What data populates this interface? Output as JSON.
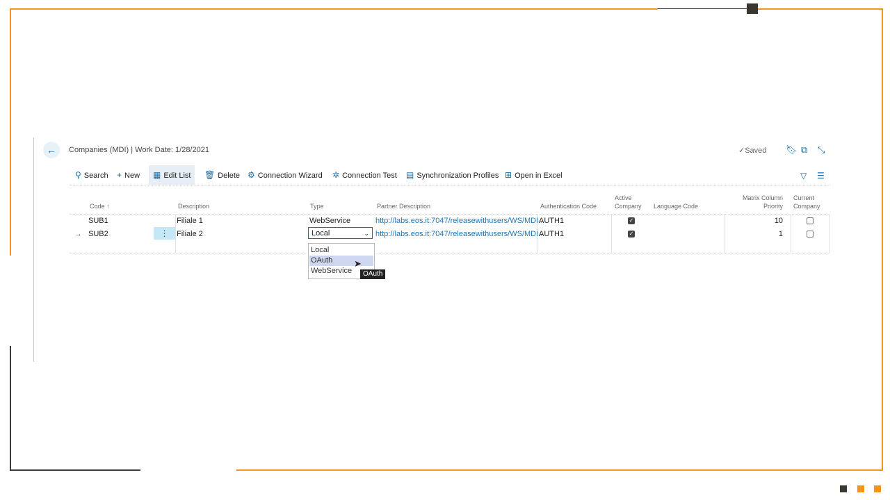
{
  "header": {
    "back_icon": "back-arrow-icon",
    "title": "Companies (MDI) | Work Date: 1/28/2021",
    "saved_label": "Saved"
  },
  "actions": [
    {
      "label": "Search",
      "icon": "search-icon"
    },
    {
      "label": "New",
      "icon": "plus-icon"
    },
    {
      "label": "Edit List",
      "icon": "edit-list-icon"
    },
    {
      "label": "Delete",
      "icon": "trash-icon"
    },
    {
      "label": "Connection Wizard",
      "icon": "wizard-icon"
    },
    {
      "label": "Connection Test",
      "icon": "connection-test-icon"
    },
    {
      "label": "Synchronization Profiles",
      "icon": "document-icon"
    },
    {
      "label": "Open in Excel",
      "icon": "excel-icon"
    }
  ],
  "columns": {
    "code": "Code ↑",
    "description": "Description",
    "type": "Type",
    "partner_description": "Partner Description",
    "authentication_code": "Authentication Code",
    "active_company_1": "Active",
    "active_company_2": "Company",
    "language_code": "Language Code",
    "matrix_1": "Matrix Column",
    "matrix_2": "Priority",
    "current_1": "Current",
    "current_2": "Company"
  },
  "rows": [
    {
      "code": "SUB1",
      "description": "Filiale 1",
      "type": "WebService",
      "partner_description": "http://labs.eos.it:7047/releasewithusers/WS/MDI...",
      "authentication_code": "AUTH1",
      "active_company": true,
      "language_code": "",
      "matrix_column_priority": "10",
      "current_company": false
    },
    {
      "code": "SUB2",
      "description": "Filiale 2",
      "type": "Local",
      "partner_description": "http://labs.eos.it:7047/releasewithusers/WS/MDI...",
      "authentication_code": "AUTH1",
      "active_company": true,
      "language_code": "",
      "matrix_column_priority": "1",
      "current_company": false
    }
  ],
  "row_arrow": "→",
  "row_menu": "⋮",
  "dropdown": {
    "options": [
      "Local",
      "OAuth",
      "WebService"
    ],
    "highlighted": "OAuth",
    "tooltip": "OAuth"
  },
  "colors": {
    "accent": "#1c6ea4",
    "frame_orange": "#f7941d",
    "frame_dark": "#3a3630"
  }
}
